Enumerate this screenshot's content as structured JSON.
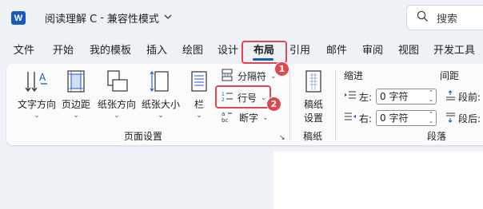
{
  "app": {
    "icon_letter": "W",
    "doc_title": "阅读理解 C",
    "separator": "-",
    "mode": "兼容性模式"
  },
  "search": {
    "label": "搜索"
  },
  "tabs": [
    "文件",
    "开始",
    "我的模板",
    "插入",
    "绘图",
    "设计",
    "布局",
    "引用",
    "邮件",
    "审阅",
    "视图",
    "开发工具"
  ],
  "active_tab": "布局",
  "badges": [
    "1",
    "2"
  ],
  "ribbon": {
    "page_setup": {
      "buttons": [
        "文字方向",
        "页边距",
        "纸张方向",
        "纸张大小",
        "栏"
      ],
      "small": {
        "breaks": "分隔符",
        "line_numbers": "行号",
        "hyphenation": "断字"
      },
      "group_label": "页面设置"
    },
    "manuscript": {
      "button": [
        "稿纸",
        "设置"
      ],
      "group_label": "稿纸"
    },
    "paragraph": {
      "indent_header": "缩进",
      "spacing_header": "间距",
      "left_label": "左:",
      "right_label": "右:",
      "left_value": "0 字符",
      "right_value": "0 字符",
      "before_label": "段前:",
      "after_label": "段后:",
      "group_label": "段落"
    }
  },
  "colors": {
    "accent": "#185abd",
    "highlight": "#e0484f"
  }
}
